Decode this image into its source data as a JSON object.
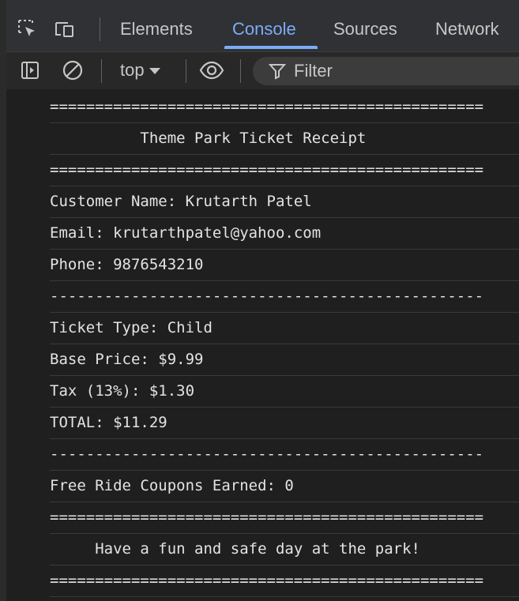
{
  "devtools": {
    "tabs": [
      {
        "label": "Elements",
        "active": false
      },
      {
        "label": "Console",
        "active": true
      },
      {
        "label": "Sources",
        "active": false
      },
      {
        "label": "Network",
        "active": false
      }
    ],
    "icons": {
      "inspect": "inspect-element-icon",
      "device": "device-toolbar-icon",
      "sidebar": "show-sidebar-icon",
      "clear": "clear-console-icon",
      "live_expression": "eye-icon",
      "filter": "filter-icon"
    },
    "accent_color": "#7cacf8"
  },
  "toolbar": {
    "context": "top",
    "filter_placeholder": "Filter"
  },
  "console": {
    "lines": [
      "================================================",
      "          Theme Park Ticket Receipt",
      "================================================",
      "Customer Name: Krutarth Patel",
      "Email: krutarthpatel@yahoo.com",
      "Phone: 9876543210",
      "------------------------------------------------",
      "Ticket Type: Child",
      "Base Price: $9.99",
      "Tax (13%): $1.30",
      "TOTAL: $11.29",
      "------------------------------------------------",
      "Free Ride Coupons Earned: 0",
      "================================================",
      "     Have a fun and safe day at the park!",
      "================================================"
    ]
  }
}
